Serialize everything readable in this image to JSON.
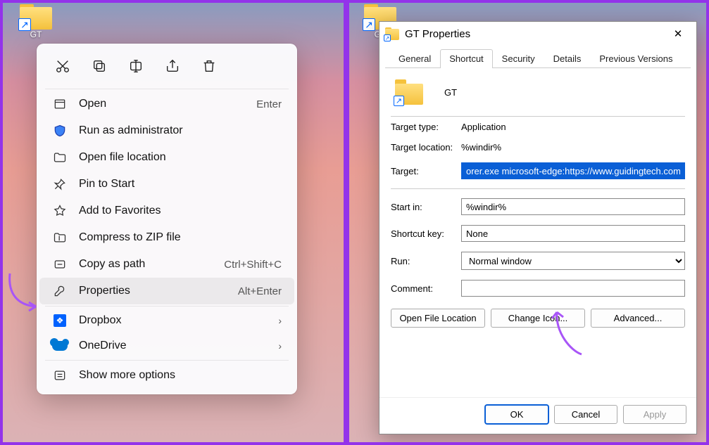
{
  "left": {
    "desktop_icon_label": "GT",
    "toolbar": [
      "cut-icon",
      "copy-icon",
      "rename-icon",
      "share-icon",
      "delete-icon"
    ],
    "menu": [
      {
        "icon": "open-icon",
        "label": "Open",
        "accel": "Enter"
      },
      {
        "icon": "shield-icon",
        "label": "Run as administrator",
        "accel": ""
      },
      {
        "icon": "folder-icon",
        "label": "Open file location",
        "accel": ""
      },
      {
        "icon": "pin-icon",
        "label": "Pin to Start",
        "accel": ""
      },
      {
        "icon": "star-icon",
        "label": "Add to Favorites",
        "accel": ""
      },
      {
        "icon": "zip-icon",
        "label": "Compress to ZIP file",
        "accel": ""
      },
      {
        "icon": "path-icon",
        "label": "Copy as path",
        "accel": "Ctrl+Shift+C"
      },
      {
        "icon": "properties-icon",
        "label": "Properties",
        "accel": "Alt+Enter",
        "highlight": true
      }
    ],
    "cloud": [
      {
        "icon": "dropbox-icon",
        "label": "Dropbox"
      },
      {
        "icon": "onedrive-icon",
        "label": "OneDrive"
      }
    ],
    "more": {
      "icon": "more-icon",
      "label": "Show more options"
    }
  },
  "right": {
    "window_title": "GT Properties",
    "tabs": [
      "General",
      "Shortcut",
      "Security",
      "Details",
      "Previous Versions"
    ],
    "active_tab": "Shortcut",
    "name": "GT",
    "target_type_label": "Target type:",
    "target_type": "Application",
    "target_location_label": "Target location:",
    "target_location": "%windir%",
    "target_label": "Target:",
    "target": "orer.exe microsoft-edge:https://www.guidingtech.com/",
    "start_in_label": "Start in:",
    "start_in": "%windir%",
    "shortcut_key_label": "Shortcut key:",
    "shortcut_key": "None",
    "run_label": "Run:",
    "run": "Normal window",
    "comment_label": "Comment:",
    "comment": "",
    "buttons": {
      "open_loc": "Open File Location",
      "change_icon": "Change Icon...",
      "advanced": "Advanced..."
    },
    "bottom": {
      "ok": "OK",
      "cancel": "Cancel",
      "apply": "Apply"
    }
  }
}
